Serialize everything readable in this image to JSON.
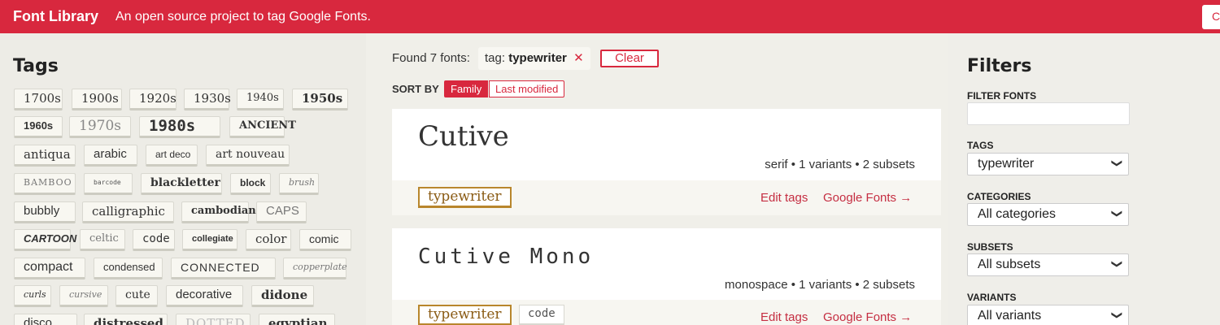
{
  "header": {
    "brand": "Font Library",
    "tagline": "An open source project to tag Google Fonts.",
    "right_button_label": "C"
  },
  "sidebar": {
    "title": "Tags",
    "tags": [
      "1700s",
      "1900s",
      "1920s",
      "1930s",
      "1940s",
      "1950s",
      "1960s",
      "1970s",
      "1980s",
      "ANCIENT",
      "antiqua",
      "arabic",
      "art deco",
      "art nouveau",
      "BAMBOO",
      "barcode",
      "blackletter",
      "block",
      "brush",
      "bubbly",
      "calligraphic",
      "cambodian",
      "CAPS",
      "CARTOON",
      "celtic",
      "code",
      "collegiate",
      "color",
      "comic",
      "compact",
      "condensed",
      "CONNECTED",
      "copperplate",
      "curls",
      "cursive",
      "cute",
      "decorative",
      "didone",
      "disco",
      "distressed",
      "DOTTED",
      "egyptian"
    ]
  },
  "main": {
    "found_text": "Found 7 fonts:",
    "active_tag_prefix": "tag:",
    "active_tag_value": "typewriter",
    "remove_symbol": "✕",
    "clear_label": "Clear",
    "sort_by_label": "SORT BY",
    "sort_options": [
      "Family",
      "Last modified"
    ],
    "fonts": [
      {
        "name": "Cutive",
        "meta": "serif • 1 variants • 2 subsets",
        "tags": [
          "typewriter"
        ],
        "edit_tags": "Edit tags",
        "google_fonts": "Google Fonts →"
      },
      {
        "name": "Cutive Mono",
        "meta": "monospace • 1 variants • 2 subsets",
        "tags": [
          "typewriter",
          "code"
        ],
        "edit_tags": "Edit tags",
        "google_fonts": "Google Fonts →"
      }
    ]
  },
  "filters": {
    "title": "Filters",
    "filter_fonts_label": "FILTER FONTS",
    "filter_fonts_value": "",
    "tags_label": "TAGS",
    "tags_value": "typewriter",
    "categories_label": "CATEGORIES",
    "categories_value": "All categories",
    "subsets_label": "SUBSETS",
    "subsets_value": "All subsets",
    "variants_label": "VARIANTS",
    "variants_value": "All variants"
  },
  "colors": {
    "brand_red": "#d8283e",
    "tag_gold": "#b8862c"
  }
}
